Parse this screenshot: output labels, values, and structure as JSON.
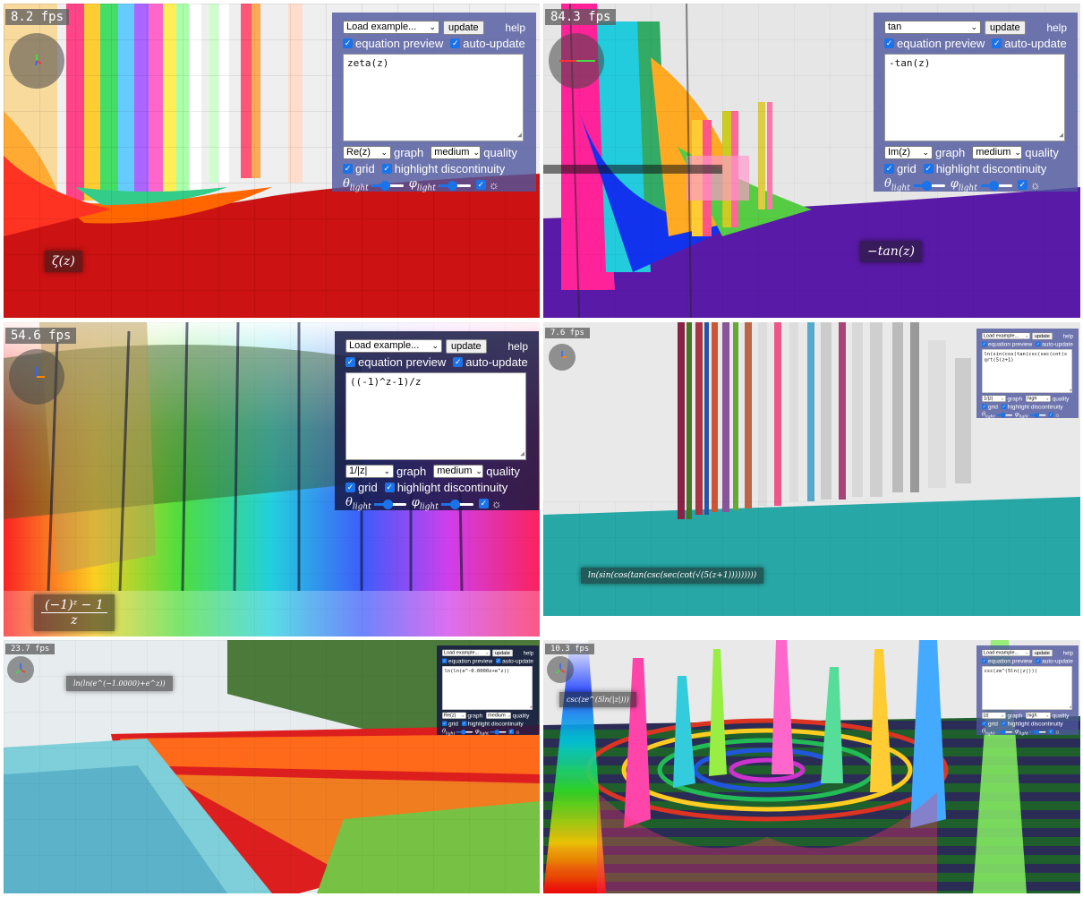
{
  "panels": [
    {
      "fps": "8.2 fps",
      "formula": "ζ(z)",
      "controls": {
        "example_select": "Load example...",
        "update_button": "update",
        "help_link": "help",
        "equation_preview_label": "equation preview",
        "auto_update_label": "auto-update",
        "equation": "zeta(z)",
        "graph_select": "Re(z)",
        "graph_label": "graph",
        "quality_select": "medium",
        "quality_label": "quality",
        "grid_label": "grid",
        "highlight_label": "highlight discontinuity",
        "sun_icon": "sun-icon"
      }
    },
    {
      "fps": "84.3 fps",
      "formula": "−tan(z)",
      "controls": {
        "example_select": "tan",
        "update_button": "update",
        "help_link": "help",
        "equation_preview_label": "equation preview",
        "auto_update_label": "auto-update",
        "equation": "-tan(z)",
        "graph_select": "Im(z)",
        "graph_label": "graph",
        "quality_select": "medium",
        "quality_label": "quality",
        "grid_label": "grid",
        "highlight_label": "highlight discontinuity",
        "sun_icon": "sun-icon"
      }
    },
    {
      "fps": "54.6 fps",
      "formula_numerator": "(−1)ᶻ − 1",
      "formula_denominator": "z",
      "controls": {
        "example_select": "Load example...",
        "update_button": "update",
        "help_link": "help",
        "equation_preview_label": "equation preview",
        "auto_update_label": "auto-update",
        "equation": "((-1)^z-1)/z",
        "graph_select": "1/|z|",
        "graph_label": "graph",
        "quality_select": "medium",
        "quality_label": "quality",
        "grid_label": "grid",
        "highlight_label": "highlight discontinuity",
        "sun_icon": "sun-icon"
      }
    },
    {
      "fps": "7.6 fps",
      "formula": "ln(sin(cos(tan(csc(sec(cot(√(5(z+1)))))))))",
      "controls": {
        "example_select": "Load example...",
        "update_button": "update",
        "help_link": "help",
        "equation_preview_label": "equation preview",
        "auto_update_label": "auto-update",
        "equation": "ln(sin(cos(tan(csc(sec(cot(sqrt(5(z+1)",
        "graph_select": "1/|z|",
        "graph_label": "graph",
        "quality_select": "high",
        "quality_label": "quality",
        "grid_label": "grid",
        "highlight_label": "highlight discontinuity",
        "sun_icon": "sun-icon"
      }
    },
    {
      "fps": "23.7 fps",
      "formula": "ln(ln(e^(−1.0000)+e^z))",
      "controls": {
        "example_select": "Load example...",
        "update_button": "update",
        "help_link": "help",
        "equation_preview_label": "equation preview",
        "auto_update_label": "auto-update",
        "equation": "ln(ln(e^-0.0000z+e^z))",
        "graph_select": "Re(z)",
        "graph_label": "graph",
        "quality_select": "medium",
        "quality_label": "quality",
        "grid_label": "grid",
        "highlight_label": "highlight discontinuity",
        "sun_icon": "sun-icon"
      }
    },
    {
      "fps": "10.3 fps",
      "formula": "csc(ze^(5ln(|z|)))",
      "controls": {
        "example_select": "Load example...",
        "update_button": "update",
        "help_link": "help",
        "equation_preview_label": "equation preview",
        "auto_update_label": "auto-update",
        "equation": "csc(ze^(5ln(|z|)))",
        "graph_select": "|z|",
        "graph_label": "graph",
        "quality_select": "high",
        "quality_label": "quality",
        "grid_label": "grid",
        "highlight_label": "highlight discontinuity",
        "sun_icon": "sun-icon"
      }
    }
  ]
}
